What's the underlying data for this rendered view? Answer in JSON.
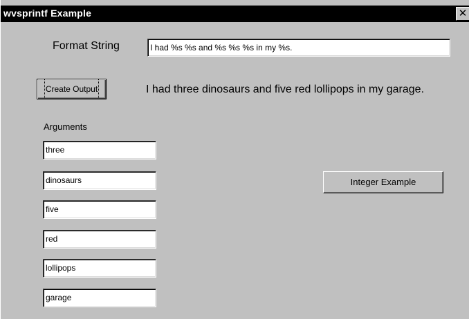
{
  "window": {
    "title": "wvsprintf Example",
    "close_glyph": "✕"
  },
  "format": {
    "label": "Format String",
    "value": "I had %s %s and %s %s %s in my %s."
  },
  "create_output": {
    "label": "Create Output"
  },
  "output_text": "I had three dinosaurs and five red lollipops in my garage.",
  "arguments": {
    "label": "Arguments",
    "values": [
      "three",
      "dinosaurs",
      "five",
      "red",
      "lollipops",
      "garage"
    ]
  },
  "integer_example": {
    "label": "Integer Example"
  }
}
